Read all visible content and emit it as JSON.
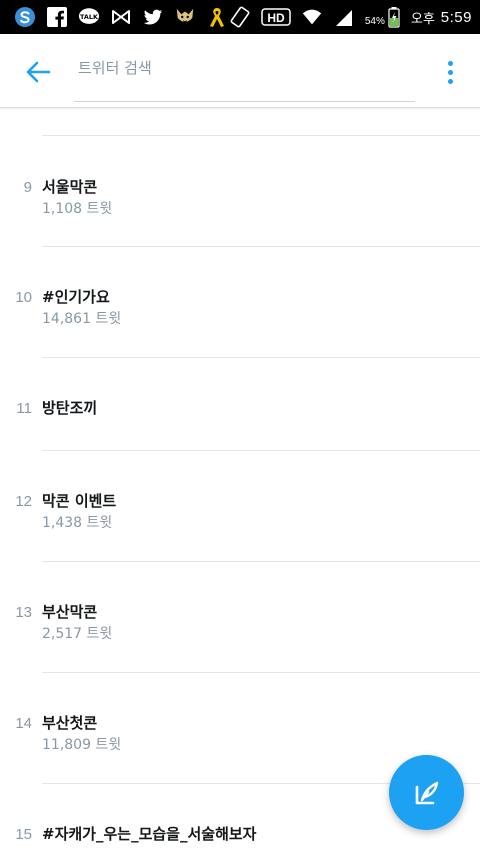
{
  "status_bar": {
    "left_icons": [
      "s-browser-icon",
      "facebook-icon",
      "kakaotalk-icon",
      "bowtie-app-icon",
      "twitter-bird-icon",
      "fox-app-icon",
      "yellow-ribbon-icon"
    ],
    "hd_label": "HD",
    "battery_percent": "54%",
    "ampm": "오후",
    "time": "5:59"
  },
  "header": {
    "search_placeholder": "트위터 검색",
    "back_icon": "arrow-left-icon",
    "more_icon": "more-vertical-icon"
  },
  "trends": [
    {
      "rank": "9",
      "name": "서울막콘",
      "count": "1,108 트윗"
    },
    {
      "rank": "10",
      "name": "#인기가요",
      "count": "14,861 트윗"
    },
    {
      "rank": "11",
      "name": "방탄조끼",
      "count": ""
    },
    {
      "rank": "12",
      "name": "막콘 이벤트",
      "count": "1,438 트윗"
    },
    {
      "rank": "13",
      "name": "부산막콘",
      "count": "2,517 트윗"
    },
    {
      "rank": "14",
      "name": "부산첫콘",
      "count": "11,809 트윗"
    },
    {
      "rank": "15",
      "name": "#자캐가_우는_모습을_서술해보자",
      "count": ""
    }
  ],
  "fab": {
    "icon": "compose-tweet-icon"
  },
  "colors": {
    "accent": "#1da1f2",
    "status_bar": "#000000",
    "secondary_text": "#8899a6",
    "primary_text": "#14171a",
    "divider": "#e1e8ed"
  }
}
